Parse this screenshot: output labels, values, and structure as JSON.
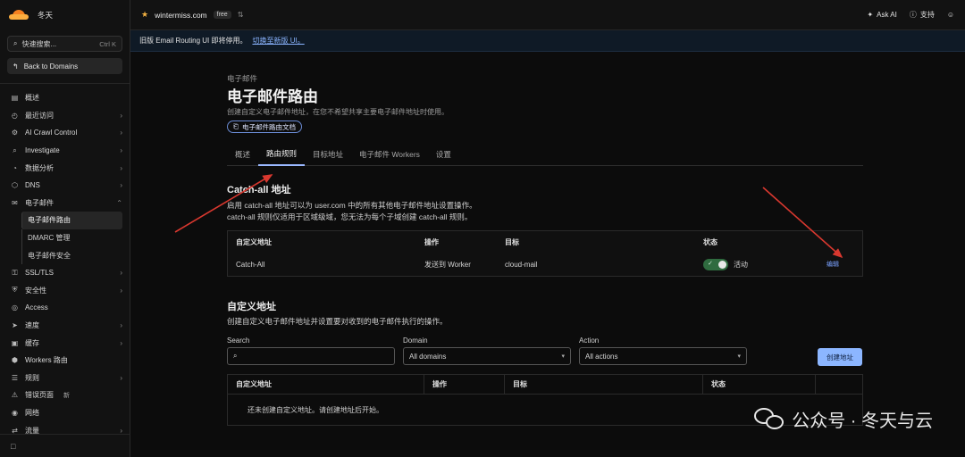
{
  "brand": {
    "name": "冬天"
  },
  "sidebar": {
    "search_label": "快速搜索...",
    "search_shortcut": "Ctrl K",
    "back_label": "Back to Domains",
    "items": [
      {
        "label": "概述",
        "icon": "file-icon",
        "chevron": false
      },
      {
        "label": "最近访问",
        "icon": "clock-icon",
        "chevron": true
      },
      {
        "label": "AI Crawl Control",
        "icon": "robot-icon",
        "chevron": true
      },
      {
        "label": "Investigate",
        "icon": "search-icon",
        "chevron": true
      },
      {
        "label": "数据分析",
        "icon": "chart-icon",
        "chevron": true
      },
      {
        "label": "DNS",
        "icon": "dns-icon",
        "chevron": true
      }
    ],
    "email_group": {
      "label": "电子邮件",
      "icon": "mail-icon"
    },
    "email_sub": [
      {
        "label": "电子邮件路由",
        "active": true
      },
      {
        "label": "DMARC 管理",
        "active": false
      },
      {
        "label": "电子邮件安全",
        "active": false
      }
    ],
    "items2": [
      {
        "label": "SSL/TLS",
        "icon": "lock-icon",
        "chevron": true
      },
      {
        "label": "安全性",
        "icon": "shield-icon",
        "chevron": true
      },
      {
        "label": "Access",
        "icon": "access-icon",
        "chevron": false
      },
      {
        "label": "速度",
        "icon": "speed-icon",
        "chevron": true
      },
      {
        "label": "缓存",
        "icon": "cache-icon",
        "chevron": true
      },
      {
        "label": "Workers 路由",
        "icon": "workers-icon",
        "chevron": false
      },
      {
        "label": "规则",
        "icon": "rules-icon",
        "chevron": true
      },
      {
        "label": "错误页面",
        "icon": "error-icon",
        "chevron": false,
        "badge": "新"
      },
      {
        "label": "网络",
        "icon": "network-icon",
        "chevron": false
      },
      {
        "label": "流量",
        "icon": "traffic-icon",
        "chevron": true
      }
    ]
  },
  "topbar": {
    "domain": "wintermiss.com",
    "plan": "free",
    "ask_ai": "Ask AI",
    "support": "支持"
  },
  "banner": {
    "text": "旧版 Email Routing UI 即将停用。",
    "link": "切换至新版 UI。"
  },
  "page": {
    "crumb": "电子邮件",
    "title": "电子邮件路由",
    "description": "创建自定义电子邮件地址，在您不希望共享主要电子邮件地址时使用。",
    "doc_button": "电子邮件路由文档",
    "tabs": [
      {
        "label": "概述",
        "active": false
      },
      {
        "label": "路由规则",
        "active": true
      },
      {
        "label": "目标地址",
        "active": false
      },
      {
        "label": "电子邮件 Workers",
        "active": false
      },
      {
        "label": "设置",
        "active": false
      }
    ]
  },
  "catchall": {
    "title": "Catch-all 地址",
    "line1": "启用 catch-all 地址可以为 user.com 中的所有其他电子邮件地址设置操作。",
    "line2": "catch-all 规则仅适用于区域级域，您无法为每个子域创建 catch-all 规则。",
    "headers": [
      "自定义地址",
      "操作",
      "目标",
      "状态"
    ],
    "row": {
      "address": "Catch-All",
      "action": "发送到 Worker",
      "target": "cloud-mail",
      "status": "活动",
      "edit": "编辑"
    }
  },
  "custom": {
    "title": "自定义地址",
    "description": "创建自定义电子邮件地址并设置要对收到的电子邮件执行的操作。",
    "search_label": "Search",
    "domain_label": "Domain",
    "domain_value": "All domains",
    "action_label": "Action",
    "action_value": "All actions",
    "create_button": "创建地址",
    "headers": [
      "自定义地址",
      "操作",
      "目标",
      "状态"
    ],
    "empty": "还未创建自定义地址。请创建地址后开始。"
  },
  "watermark": {
    "text": "公众号 · 冬天与云"
  },
  "colors": {
    "accent": "#8cb6ff",
    "brand_orange": "#f48120",
    "arrow": "#d9382f",
    "toggle_on": "#2f6b3f"
  }
}
